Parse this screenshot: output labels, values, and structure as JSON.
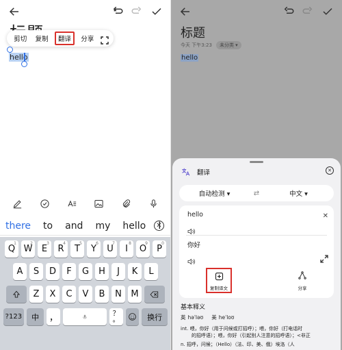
{
  "left": {
    "note_title_partial": "标题",
    "context_menu": [
      "剪切",
      "复制",
      "翻译",
      "分享"
    ],
    "selected_text": "hello",
    "suggestions": [
      "there",
      "to",
      "and",
      "my",
      "hello",
      "I"
    ],
    "keyboard": {
      "row1": [
        "Q",
        "W",
        "E",
        "R",
        "T",
        "Y",
        "U",
        "I",
        "O",
        "P"
      ],
      "row1_nums": [
        "1",
        "2",
        "3",
        "4",
        "5",
        "6",
        "7",
        "8",
        "9",
        "0"
      ],
      "row2": [
        "A",
        "S",
        "D",
        "F",
        "G",
        "H",
        "J",
        "K",
        "L"
      ],
      "row3": [
        "Z",
        "X",
        "C",
        "V",
        "B",
        "N",
        "M"
      ],
      "key_123": "?123",
      "key_lang": "中",
      "key_comma": "，",
      "key_period": "。",
      "key_question": "？",
      "key_enter": "换行"
    }
  },
  "right": {
    "note_title": "标题",
    "meta_time": "今天 下午3:23",
    "meta_category": "未分类",
    "selected_text": "hello",
    "sheet": {
      "title": "翻译",
      "source_lang": "自动检测",
      "target_lang": "中文",
      "source_text": "hello",
      "translated_text": "你好",
      "copy_label": "复制译文",
      "share_label": "分享",
      "def_title": "基本释义",
      "uk_label": "英",
      "uk_phonetic": "həˈləʊ",
      "us_label": "美",
      "us_phonetic": "heˈloʊ",
      "def_int_1": "int. 喂，你好（用于问候或打招呼）；喂，你好（打电话时",
      "def_int_2": "的招呼语）；喂，你好（引起别人注意的招呼语）；<非正",
      "def_n": "n. 招呼，问候；（Hello）（法、印、美、俄）埃洛（人"
    }
  }
}
